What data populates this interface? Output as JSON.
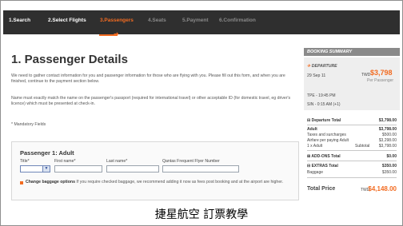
{
  "steps": [
    {
      "label": "1.Search"
    },
    {
      "label": "2.Select Flights"
    },
    {
      "label": "3.Passengers"
    },
    {
      "label": "4.Seats"
    },
    {
      "label": "5.Payment"
    },
    {
      "label": "6.Confirmation"
    }
  ],
  "main": {
    "title": "1. Passenger Details",
    "intro": "We need to gather contact information for you and passenger information for those who are flying with you. Please fill out this form, and when you are finished, continue to the payment section below.",
    "name_note": "Name must exactly match the name on the passenger's passport (required for international travel) or other acceptable ID (for domestic travel, eg driver's licence) which must be presented at check-in.",
    "mandatory": "* Mandatory Fields"
  },
  "passenger": {
    "heading": "Passenger 1: Adult",
    "labels": {
      "title": "Title*",
      "first": "First name*",
      "last": "Last name*",
      "ff": "Qantas Frequent Flyer Number"
    },
    "baggage_link": "Change baggage options",
    "baggage_text": " If you require checked baggage, we recommend adding it now as fees post booking and at the airport are higher."
  },
  "summary": {
    "heading": "BOOKING SUMMARY",
    "departure_label": "DEPARTURE",
    "date": "29 Sep 11",
    "currency": "TWD",
    "price": "$3,798",
    "per_passenger": "Per Passenger",
    "route_from": "TPE - 19:45 PM",
    "route_to": "SIN - 0:15 AM (+1)",
    "rows": [
      {
        "label": "Departure Total",
        "value": "$3,798.00"
      },
      {
        "label": "Adult",
        "value": "$3,798.00"
      },
      {
        "label": "Taxes and surcharges",
        "value": "$500.00"
      },
      {
        "label": "Airfare per paying Adult",
        "value": "$3,298.00"
      },
      {
        "label": "1 x Adult",
        "mid": "Subtotal",
        "value": "$3,798.00"
      },
      {
        "label": "ADD-ONS Total",
        "value": "$0.00"
      },
      {
        "label": "EXTRAS Total",
        "value": "$350.00"
      },
      {
        "label": "Baggage",
        "value": "$350.00"
      }
    ],
    "total_label": "Total Price",
    "total_currency": "TWD",
    "total_value": "$4,148.00"
  },
  "caption": "捷星航空 訂票教學",
  "colors": {
    "accent": "#f26b21",
    "stepbar": "#2f2f2f",
    "panel": "#eeeeee",
    "header": "#8a8a8a"
  }
}
